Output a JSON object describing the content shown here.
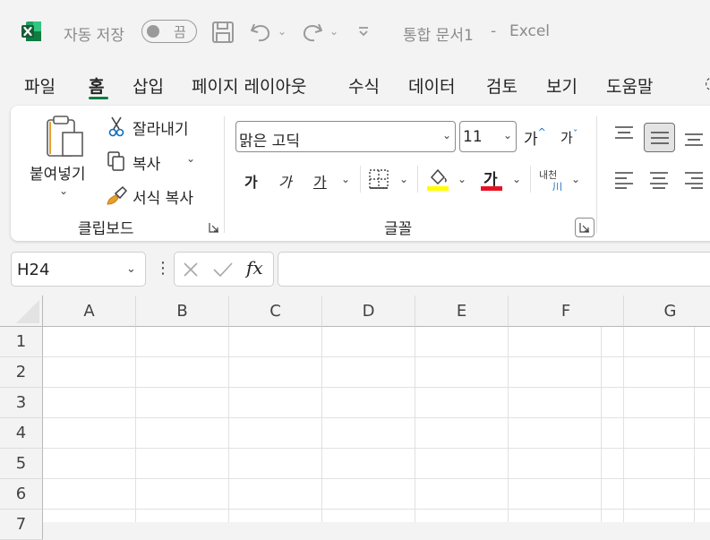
{
  "titlebar": {
    "autosave_label": "자동 저장",
    "autosave_state": "끔",
    "doc_title": "통합 문서1",
    "separator": "-",
    "app_name": "Excel"
  },
  "tabs": [
    "파일",
    "홈",
    "삽입",
    "페이지 레이아웃",
    "수식",
    "데이터",
    "검토",
    "보기",
    "도움말"
  ],
  "active_tab": "홈",
  "ribbon": {
    "clipboard": {
      "paste_label": "붙여넣기",
      "cut_label": "잘라내기",
      "copy_label": "복사",
      "format_painter_label": "서식 복사",
      "group_label": "클립보드"
    },
    "font": {
      "font_name": "맑은 고딕",
      "font_size": "11",
      "grow_label": "가",
      "shrink_label": "가",
      "bold_label": "가",
      "italic_label": "가",
      "underline_label": "가",
      "font_color_label": "가",
      "phonetic_label_top": "내천",
      "phonetic_label_bottom": "川",
      "group_label": "글꼴",
      "highlight_color": "#ffff00",
      "font_color": "#e81123"
    }
  },
  "formula_bar": {
    "name_box": "H24",
    "fx_label": "fx",
    "formula": ""
  },
  "grid": {
    "columns": [
      "A",
      "B",
      "C",
      "D",
      "E",
      "F",
      "G"
    ],
    "rows": [
      "1",
      "2",
      "3",
      "4",
      "5",
      "6",
      "7"
    ]
  },
  "colors": {
    "accent": "#107c41",
    "logo": "#1d6f42"
  }
}
